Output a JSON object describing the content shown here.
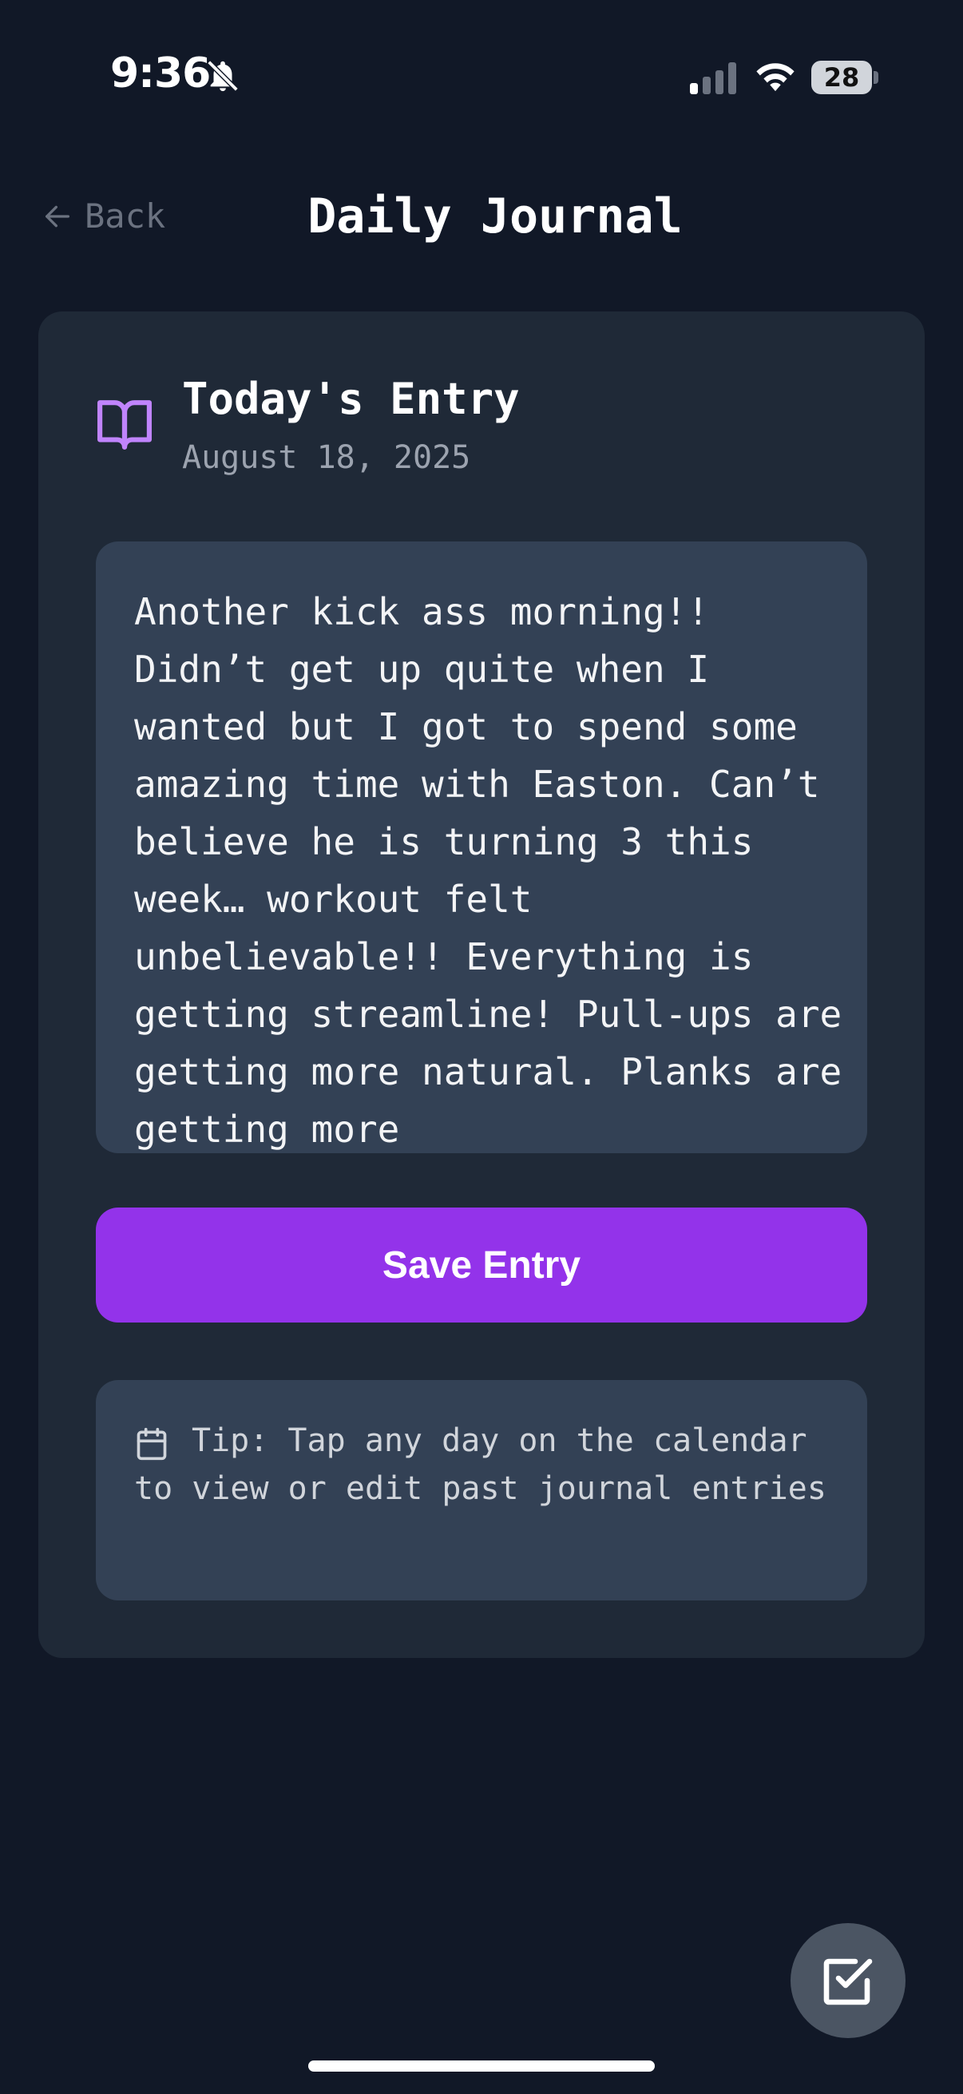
{
  "status_bar": {
    "time": "9:36",
    "battery": "28",
    "icons": [
      "bell-off-icon",
      "signal-icon",
      "wifi-icon",
      "battery-icon"
    ]
  },
  "header": {
    "back_label": "Back",
    "title": "Daily Journal"
  },
  "entry": {
    "title": "Today's Entry",
    "date": "August 18, 2025",
    "icon": "book-open-icon",
    "text": "Another kick ass morning!! Didn’t get up quite when I wanted but I got to spend some amazing time with Easton. Can’t believe he is turning 3 this week… workout felt unbelievable!! Everything is getting streamline! Pull-ups are getting more natural. Planks are getting more"
  },
  "actions": {
    "save_label": "Save Entry"
  },
  "tip": {
    "icon": "calendar-icon",
    "text": "Tip: Tap any day on the calendar to view or edit past journal entries"
  },
  "fab": {
    "icon": "check-square-icon"
  },
  "colors": {
    "background": "#111827",
    "card": "#1f2937",
    "input": "#334155",
    "accent": "#9333ea",
    "icon_accent": "#c084fc"
  }
}
